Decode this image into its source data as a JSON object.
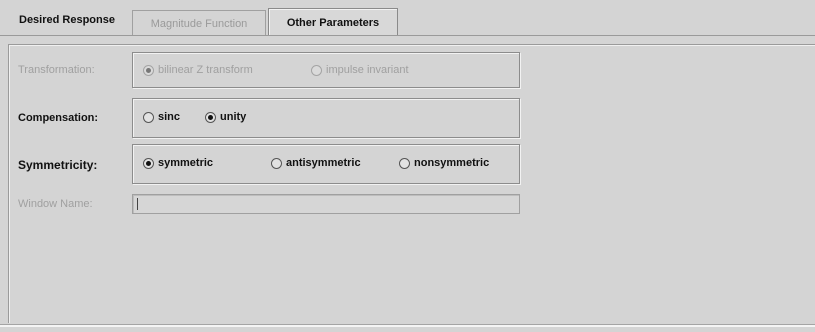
{
  "tabs": [
    {
      "label": "Desired Response",
      "state": "normal"
    },
    {
      "label": "Magnitude Function",
      "state": "disabled"
    },
    {
      "label": "Other Parameters",
      "state": "selected"
    }
  ],
  "transformation": {
    "label": "Transformation:",
    "options": [
      "bilinear Z transform",
      "impulse invariant"
    ],
    "selected": 0,
    "enabled": false
  },
  "compensation": {
    "label": "Compensation:",
    "options": [
      "sinc",
      "unity"
    ],
    "selected": 1
  },
  "symmetricity": {
    "label": "Symmetricity:",
    "options": [
      "symmetric",
      "antisymmetric",
      "nonsymmetric"
    ],
    "selected": 0
  },
  "window_name": {
    "label": "Window Name:",
    "value": "",
    "enabled": false
  },
  "colors": {
    "background": "#d4d4d4",
    "disabled_text": "#a0a0a0",
    "text": "#111111"
  }
}
